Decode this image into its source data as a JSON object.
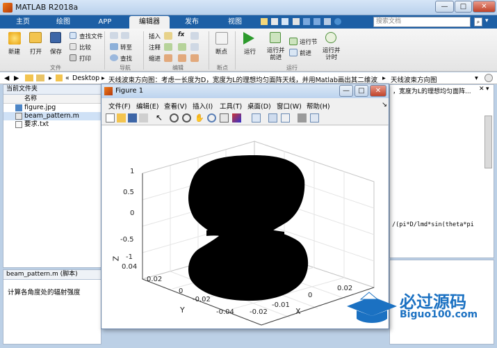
{
  "window": {
    "title": "MATLAB R2018a"
  },
  "tabs": [
    "主页",
    "绘图",
    "APP",
    "编辑器",
    "发布",
    "视图"
  ],
  "active_tab": "编辑器",
  "search": {
    "placeholder": "搜索文档"
  },
  "ribbon": {
    "file": {
      "new": "新建",
      "open": "打开",
      "save": "保存",
      "find_files": "查找文件",
      "compare": "比较",
      "print": "打印",
      "group": "文件"
    },
    "nav": {
      "goto": "转至",
      "find": "查找",
      "group": "导航"
    },
    "edit": {
      "insert": "插入",
      "comment": "注释",
      "indent": "缩进",
      "group": "编辑"
    },
    "breakpoints": {
      "label": "断点",
      "group": "断点"
    },
    "run": {
      "run": "运行",
      "run_advance": "运行并\n前进",
      "run_section": "运行节",
      "advance": "前进",
      "run_time": "运行并\n计时",
      "group": "运行"
    }
  },
  "address": {
    "root": "Desktop",
    "path1": "天线波束方向图：考虑一长度为D，宽度为L的理想均匀面阵天线，并用Matlab画出其二维波束方向图",
    "path2": "天线波束方向图"
  },
  "current_folder": {
    "title": "当前文件夹",
    "col_name": "名称",
    "files": [
      {
        "name": "figure.jpg",
        "type": "image"
      },
      {
        "name": "beam_pattern.m",
        "type": "script",
        "selected": true
      },
      {
        "name": "要求.txt",
        "type": "text"
      }
    ]
  },
  "details": {
    "title": "beam_pattern.m  (脚本)",
    "description": "计算各角度处的辐射强度"
  },
  "editor": {
    "tab_fragment": "，宽度为L的理想均匀面阵...",
    "code_fragment": "/(pi*D/lmd*sin(theta*pi"
  },
  "figure": {
    "title": "Figure 1",
    "menus": [
      "文件(F)",
      "编辑(E)",
      "查看(V)",
      "插入(I)",
      "工具(T)",
      "桌面(D)",
      "窗口(W)",
      "帮助(H)"
    ],
    "z_ticks": [
      "1",
      "0.5",
      "0",
      "-0.5",
      "-1"
    ],
    "y_ticks": [
      "0.04",
      "0.02",
      "0",
      "-0.02",
      "-0.04"
    ],
    "x_ticks": [
      "0.02",
      "0",
      "-0.01",
      "-0.02"
    ],
    "labels": {
      "x": "X",
      "y": "Y",
      "z": "Z"
    }
  },
  "watermark": {
    "brand": "必过源码",
    "site": "Biguo100.com"
  }
}
